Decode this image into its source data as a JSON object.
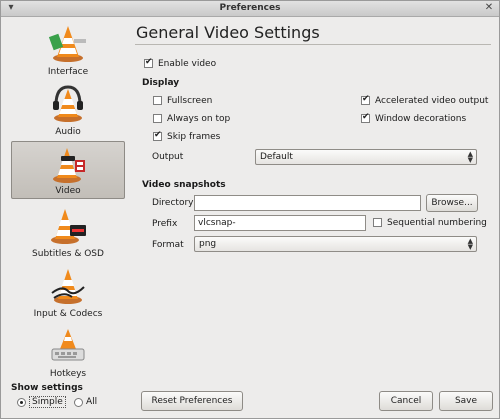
{
  "window": {
    "title": "Preferences"
  },
  "sidebar": {
    "items": [
      {
        "label": "Interface",
        "active": false
      },
      {
        "label": "Audio",
        "active": false
      },
      {
        "label": "Video",
        "active": true
      },
      {
        "label": "Subtitles & OSD",
        "active": false
      },
      {
        "label": "Input & Codecs",
        "active": false
      },
      {
        "label": "Hotkeys",
        "active": false
      }
    ]
  },
  "show_settings": {
    "label": "Show settings",
    "options": [
      "Simple",
      "All"
    ],
    "selected": "Simple"
  },
  "main": {
    "title": "General Video Settings",
    "enable_video": {
      "label": "Enable video",
      "checked": true
    },
    "display": {
      "heading": "Display",
      "fullscreen": {
        "label": "Fullscreen",
        "checked": false
      },
      "always_on_top": {
        "label": "Always on top",
        "checked": false
      },
      "skip_frames": {
        "label": "Skip frames",
        "checked": true
      },
      "accelerated": {
        "label": "Accelerated video output",
        "checked": true
      },
      "decorations": {
        "label": "Window decorations",
        "checked": true
      },
      "output_label": "Output",
      "output_value": "Default"
    },
    "snapshots": {
      "heading": "Video snapshots",
      "directory_label": "Directory",
      "directory_value": "",
      "browse_label": "Browse...",
      "prefix_label": "Prefix",
      "prefix_value": "vlcsnap-",
      "sequential": {
        "label": "Sequential numbering",
        "checked": false
      },
      "format_label": "Format",
      "format_value": "png"
    }
  },
  "footer": {
    "reset_label": "Reset Preferences",
    "cancel_label": "Cancel",
    "save_label": "Save"
  }
}
